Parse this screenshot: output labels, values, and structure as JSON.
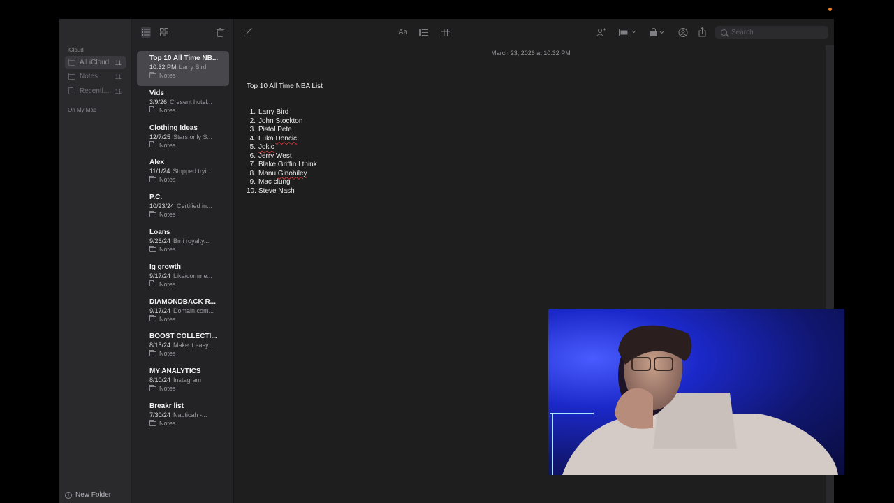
{
  "sidebar": {
    "section_icloud": "iCloud",
    "section_mac": "On My Mac",
    "folders": [
      {
        "label": "All iCloud",
        "count": "11"
      },
      {
        "label": "Notes",
        "count": "11"
      },
      {
        "label": "Recentl...",
        "count": "11"
      }
    ],
    "new_folder_label": "New Folder"
  },
  "toolbar": {
    "search_placeholder": "Search",
    "icons": [
      "list-view-icon",
      "gallery-view-icon",
      "trash-icon",
      "compose-icon",
      "text-format-icon",
      "checklist-icon",
      "table-icon",
      "collaborate-icon",
      "media-icon",
      "lock-icon",
      "share-icon",
      "export-icon"
    ]
  },
  "notes": [
    {
      "title": "Top 10 All Time NB...",
      "date": "10:32 PM",
      "preview": "Larry Bird",
      "folder": "Notes"
    },
    {
      "title": "Vids",
      "date": "3/9/26",
      "preview": "Cresent hotel...",
      "folder": "Notes"
    },
    {
      "title": "Clothing Ideas",
      "date": "12/7/25",
      "preview": "Stars only S...",
      "folder": "Notes"
    },
    {
      "title": "Alex",
      "date": "11/1/24",
      "preview": "Stopped tryi...",
      "folder": "Notes"
    },
    {
      "title": "P.C.",
      "date": "10/23/24",
      "preview": "Certified in...",
      "folder": "Notes"
    },
    {
      "title": "Loans",
      "date": "9/26/24",
      "preview": "Bmi royalty...",
      "folder": "Notes"
    },
    {
      "title": "Ig growth",
      "date": "9/17/24",
      "preview": "Like/comme...",
      "folder": "Notes"
    },
    {
      "title": "DIAMONDBACK R...",
      "date": "9/17/24",
      "preview": "Domain.com...",
      "folder": "Notes"
    },
    {
      "title": "BOOST COLLECTI...",
      "date": "8/15/24",
      "preview": "Make it easy...",
      "folder": "Notes"
    },
    {
      "title": "MY ANALYTICS",
      "date": "8/10/24",
      "preview": "Instagram",
      "folder": "Notes"
    },
    {
      "title": "Breakr list",
      "date": "7/30/24",
      "preview": "Nauticah -...",
      "folder": "Notes"
    }
  ],
  "editor": {
    "timestamp": "March 23, 2026 at 10:32 PM",
    "title": "Top 10 All Time NBA List",
    "lines": [
      {
        "num": "1.",
        "text": "Larry Bird"
      },
      {
        "num": "2.",
        "text": "John Stockton"
      },
      {
        "num": "3.",
        "text": "Pistol Pete"
      },
      {
        "num": "4.",
        "pre": "Luka ",
        "spell": "Doncic",
        "post": ""
      },
      {
        "num": "5.",
        "pre": "",
        "spell": "Jokic",
        "post": ""
      },
      {
        "num": "6.",
        "text": "Jerry West"
      },
      {
        "num": "7.",
        "text": "Blake Griffin I think"
      },
      {
        "num": "8.",
        "pre": "Manu ",
        "spell": "Ginobiley",
        "post": ""
      },
      {
        "num": "9.",
        "text": "Mac clung"
      },
      {
        "num": "10.",
        "text": "Steve Nash"
      }
    ]
  },
  "colors": {
    "window_bg": "#1e1e1e",
    "sidebar_bg": "#2a2a2d",
    "selected_note": "#48484c",
    "recording_dot": "#e8822e"
  }
}
